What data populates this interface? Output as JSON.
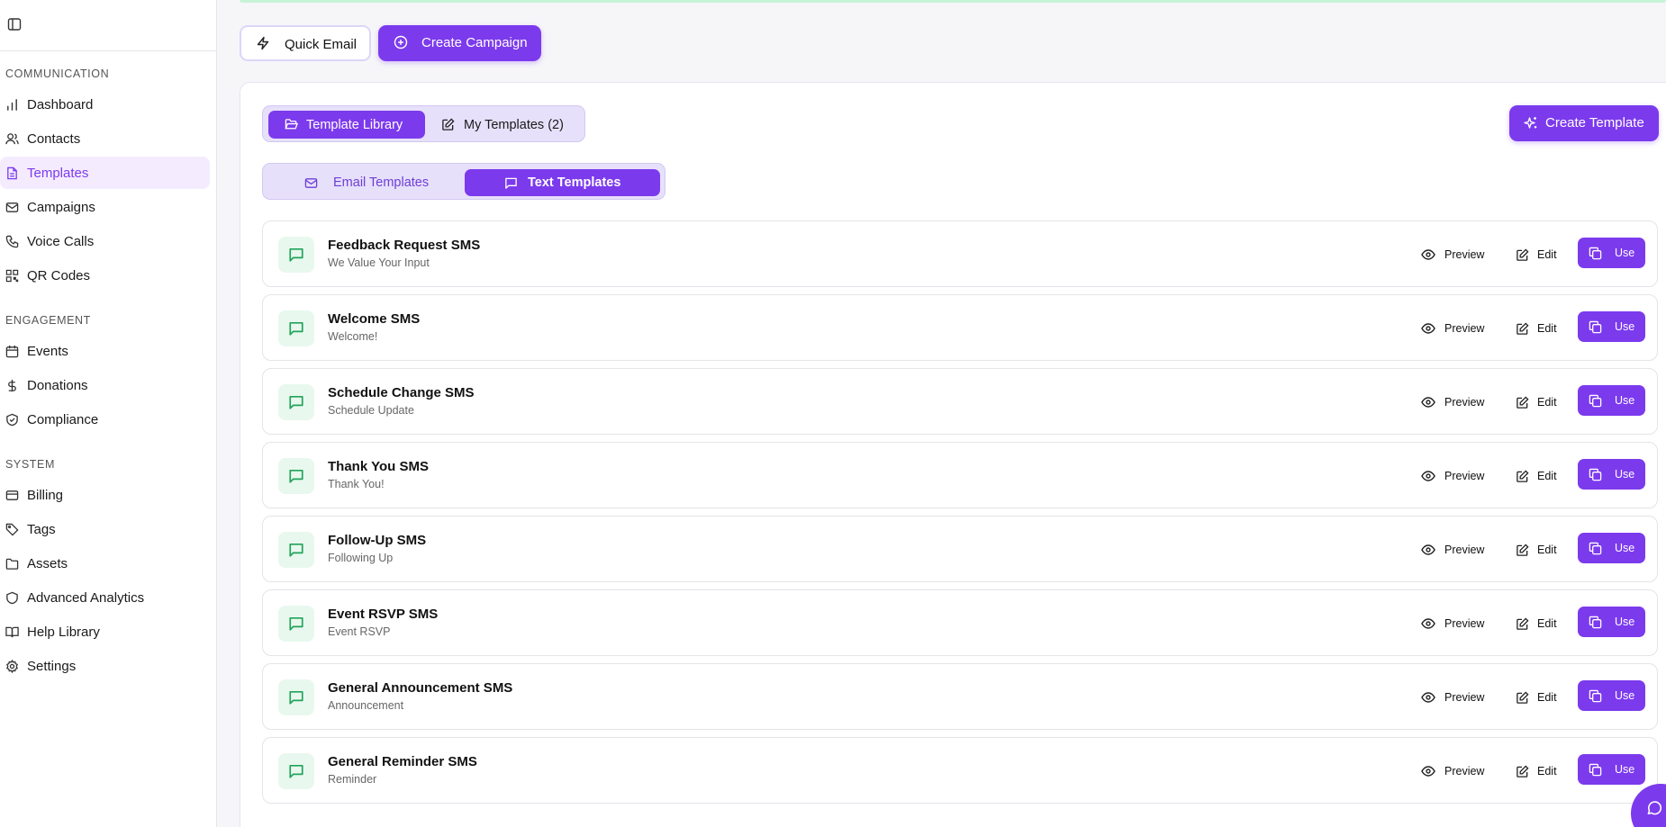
{
  "sidebar": {
    "sections": [
      {
        "title": "COMMUNICATION",
        "items": [
          {
            "label": "Dashboard",
            "icon": "bar-chart-icon"
          },
          {
            "label": "Contacts",
            "icon": "users-icon"
          },
          {
            "label": "Templates",
            "icon": "file-text-icon",
            "active": true
          },
          {
            "label": "Campaigns",
            "icon": "mail-icon"
          },
          {
            "label": "Voice Calls",
            "icon": "phone-icon"
          },
          {
            "label": "QR Codes",
            "icon": "qr-code-icon"
          }
        ]
      },
      {
        "title": "ENGAGEMENT",
        "items": [
          {
            "label": "Events",
            "icon": "calendar-icon"
          },
          {
            "label": "Donations",
            "icon": "dollar-icon"
          },
          {
            "label": "Compliance",
            "icon": "shield-check-icon"
          }
        ]
      },
      {
        "title": "SYSTEM",
        "items": [
          {
            "label": "Billing",
            "icon": "credit-card-icon"
          },
          {
            "label": "Tags",
            "icon": "tag-icon"
          },
          {
            "label": "Assets",
            "icon": "folder-icon"
          },
          {
            "label": "Advanced Analytics",
            "icon": "shield-icon"
          },
          {
            "label": "Help Library",
            "icon": "book-icon"
          },
          {
            "label": "Settings",
            "icon": "gear-icon"
          }
        ]
      }
    ]
  },
  "toolbar": {
    "quick_email_label": "Quick Email",
    "create_campaign_label": "Create Campaign"
  },
  "library_tabs": {
    "template_library": "Template Library",
    "my_templates": "My Templates (2)",
    "active": "template_library"
  },
  "create_template_label": "Create Template",
  "type_tabs": {
    "email": "Email Templates",
    "text": "Text Templates",
    "active": "text"
  },
  "actions": {
    "preview": "Preview",
    "edit": "Edit",
    "use": "Use"
  },
  "templates": [
    {
      "title": "Feedback Request SMS",
      "subtitle": "We Value Your Input"
    },
    {
      "title": "Welcome SMS",
      "subtitle": "Welcome!"
    },
    {
      "title": "Schedule Change SMS",
      "subtitle": "Schedule Update"
    },
    {
      "title": "Thank You SMS",
      "subtitle": "Thank You!"
    },
    {
      "title": "Follow-Up SMS",
      "subtitle": "Following Up"
    },
    {
      "title": "Event RSVP SMS",
      "subtitle": "Event RSVP"
    },
    {
      "title": "General Announcement SMS",
      "subtitle": "Announcement"
    },
    {
      "title": "General Reminder SMS",
      "subtitle": "Reminder"
    }
  ],
  "colors": {
    "accent": "#7c3aed",
    "accent_light": "#f4ecfe",
    "sms_icon": "#22a35a",
    "sms_badge_bg": "#e8f8ee"
  }
}
